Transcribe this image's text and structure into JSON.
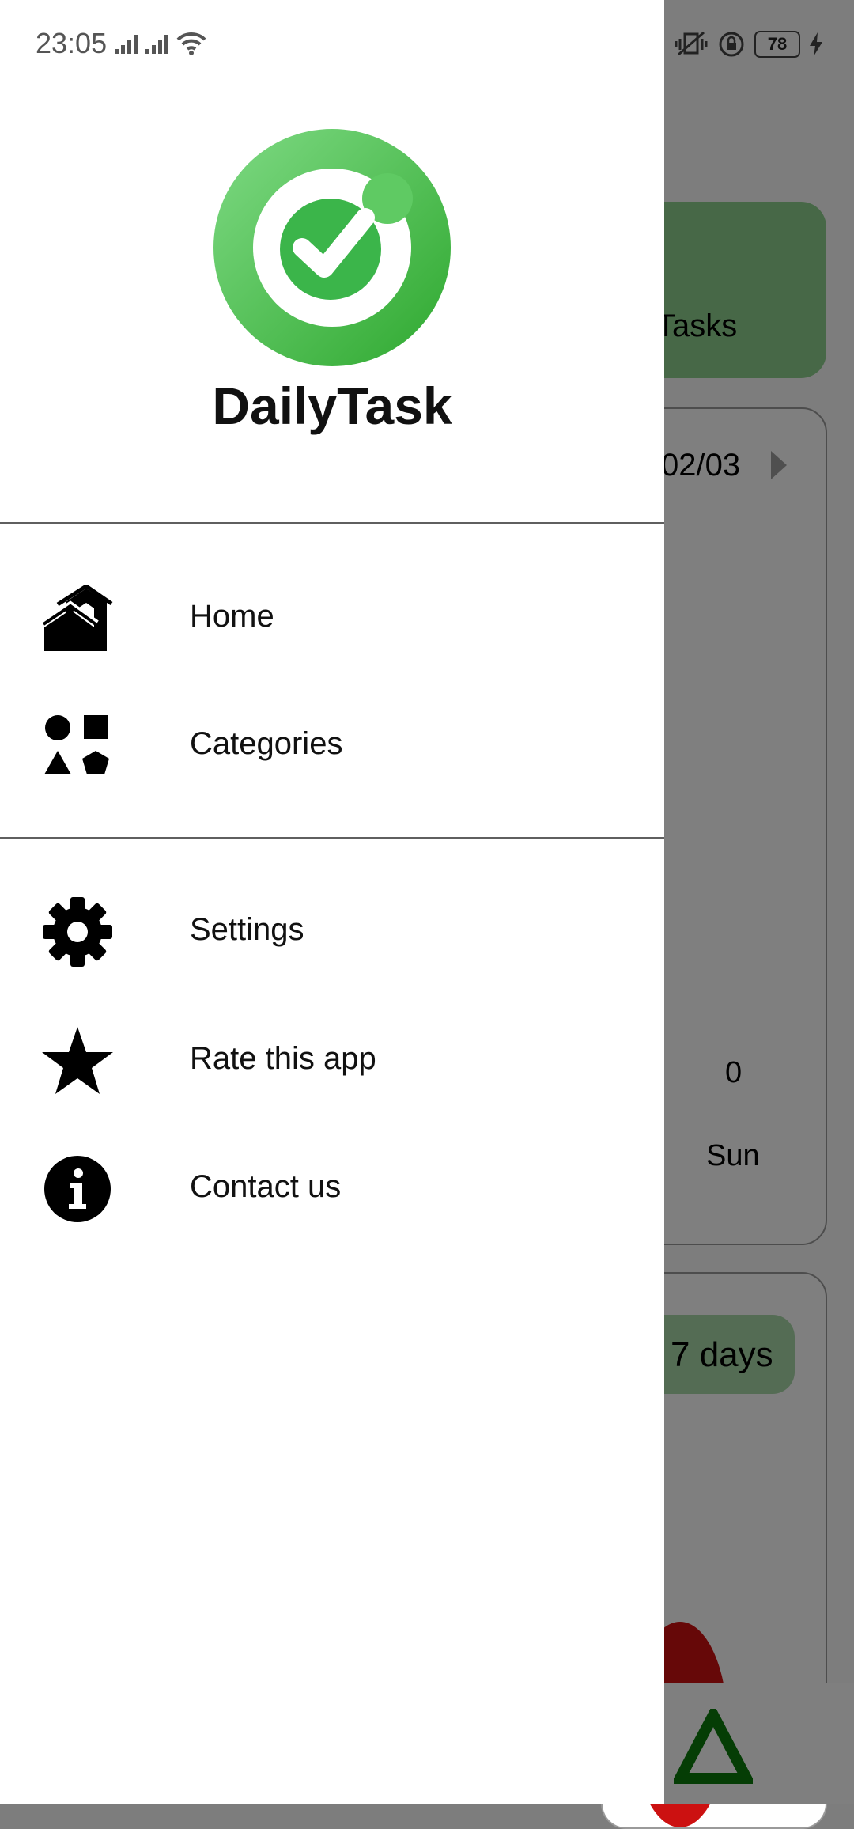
{
  "status_bar": {
    "time": "23:05",
    "battery": "78",
    "icons": [
      "cell-signal-icon",
      "cell-signal-icon",
      "wifi-icon",
      "vibrate-icon",
      "rotation-lock-icon",
      "battery-icon",
      "charging-icon"
    ]
  },
  "drawer": {
    "app_name": "DailyTask",
    "logo_icon": "checkmark-circle-logo",
    "brand_color": "#3bb54a",
    "items_primary": [
      {
        "label": "Home",
        "icon": "home-icon"
      },
      {
        "label": "Categories",
        "icon": "categories-icon"
      }
    ],
    "items_secondary": [
      {
        "label": "Settings",
        "icon": "gear-icon"
      },
      {
        "label": "Rate this app",
        "icon": "star-icon"
      },
      {
        "label": "Contact us",
        "icon": "info-icon"
      }
    ]
  },
  "background": {
    "top_card_label": "Tasks",
    "date_text": "02/03",
    "day_count": "0",
    "day_label": "Sun",
    "range_pill": "7 days"
  }
}
